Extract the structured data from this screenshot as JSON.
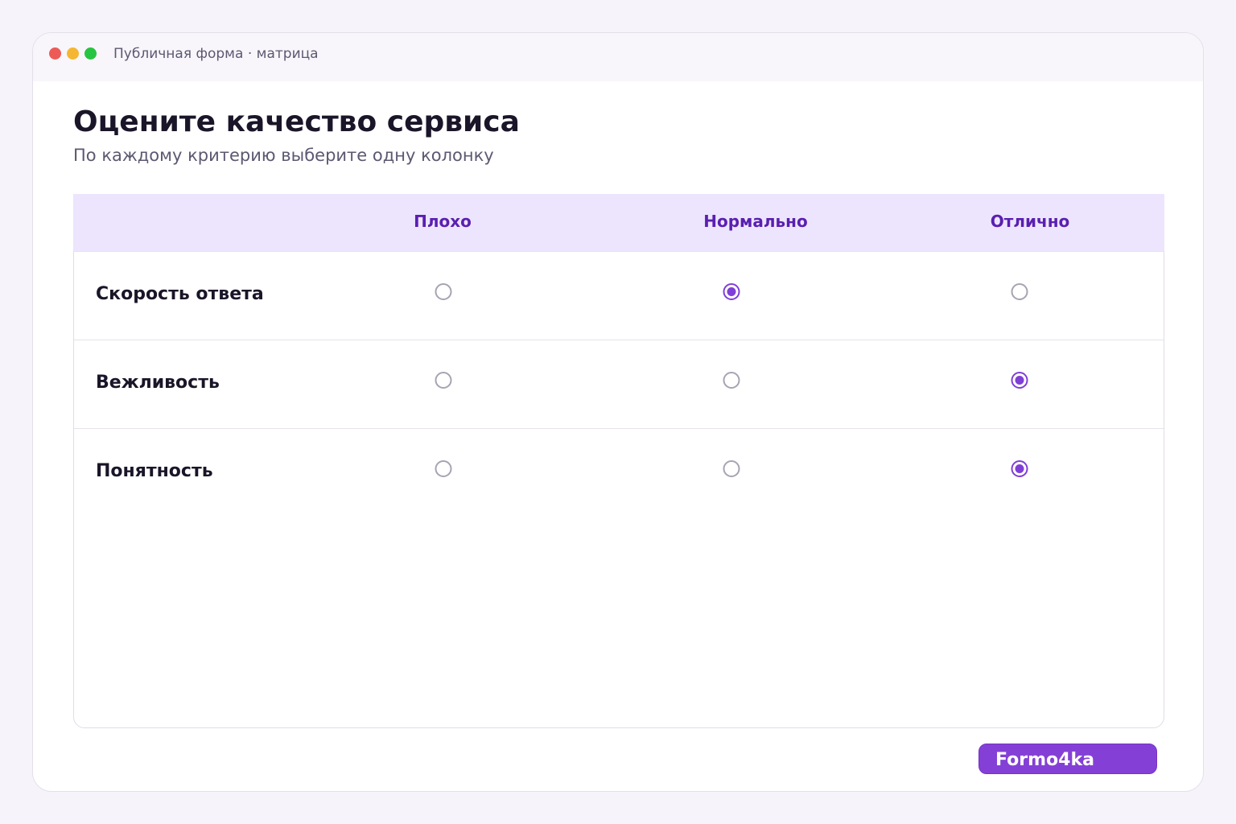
{
  "window": {
    "title": "Публичная форма · матрица"
  },
  "form": {
    "title": "Оцените качество сервиса",
    "subtitle": "По каждому критерию выберите одну колонку"
  },
  "matrix": {
    "columns": [
      "Плохо",
      "Нормально",
      "Отлично"
    ],
    "rows": [
      {
        "label": "Скорость ответа",
        "selected": "Нормально"
      },
      {
        "label": "Вежливость",
        "selected": "Отлично"
      },
      {
        "label": "Понятность",
        "selected": "Отлично"
      }
    ]
  },
  "brand": {
    "label": "Formo4ka",
    "color": "#8440d6"
  },
  "colors": {
    "accent": "#7f3fd6",
    "header_bg": "#ede5fd",
    "header_text": "#5a1fb0"
  }
}
